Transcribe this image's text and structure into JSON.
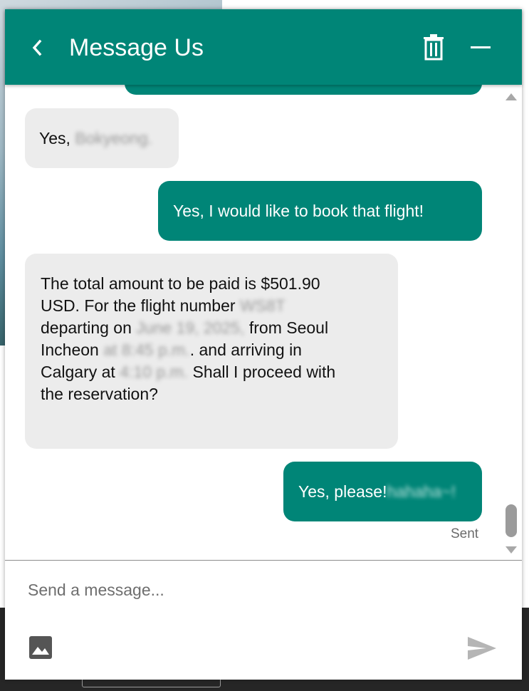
{
  "header": {
    "title": "Message Us",
    "back_icon": "chevron-left-icon",
    "delete_icon": "trash-icon",
    "minimize_icon": "minimize-icon",
    "bg_color": "#008577"
  },
  "messages": [
    {
      "role": "agent",
      "text_visible": "Yes,",
      "blurred": "Bokyeong."
    },
    {
      "role": "user",
      "text": "Yes, I would like to book that flight!"
    },
    {
      "role": "agent",
      "lines": [
        {
          "parts": [
            "The total amount to be paid is $501.90"
          ]
        },
        {
          "parts": [
            "USD. For the flight number "
          ],
          "blurred": "WS8T"
        },
        {
          "parts": [
            "departing on "
          ],
          "blurred": "June 19, 2025,",
          "after": " from Seoul"
        },
        {
          "parts": [
            "Incheon "
          ],
          "blurred": "at 8:45 p.m.",
          "after": ". and arriving in"
        },
        {
          "parts": [
            "Calgary at "
          ],
          "blurred": "4:10 p.m.",
          "after": " Shall I proceed with"
        },
        {
          "parts": [
            "the reservation?"
          ]
        }
      ]
    },
    {
      "role": "user",
      "text_visible": "Yes, please!",
      "blurred": " hahaha~!"
    }
  ],
  "status": {
    "sent": "Sent"
  },
  "composer": {
    "placeholder": "Send a message...",
    "image_icon": "image-icon",
    "send_icon": "send-icon"
  },
  "colors": {
    "user_bubble": "#008577",
    "agent_bubble": "#ececec"
  }
}
